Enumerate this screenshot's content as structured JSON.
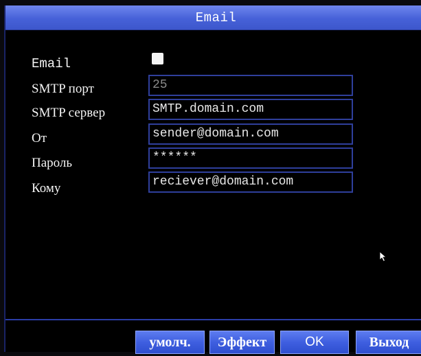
{
  "window": {
    "title": "Email"
  },
  "form": {
    "email_label": "Email",
    "email_enabled": true,
    "rows": [
      {
        "label": "SMTP порт",
        "value": "25"
      },
      {
        "label": "SMTP сервер",
        "value": "SMTP.domain.com"
      },
      {
        "label": "От",
        "value": "sender@domain.com"
      },
      {
        "label": "Пароль",
        "value": "******"
      },
      {
        "label": "Кому",
        "value": "reciever@domain.com"
      }
    ]
  },
  "buttons": {
    "default": "умолч.",
    "effect": "Эффект",
    "ok": "OK",
    "exit": "Выход"
  },
  "colors": {
    "title_bar": "#4661d8",
    "field_border": "#2f3f9c",
    "button": "#3f5fe0"
  }
}
